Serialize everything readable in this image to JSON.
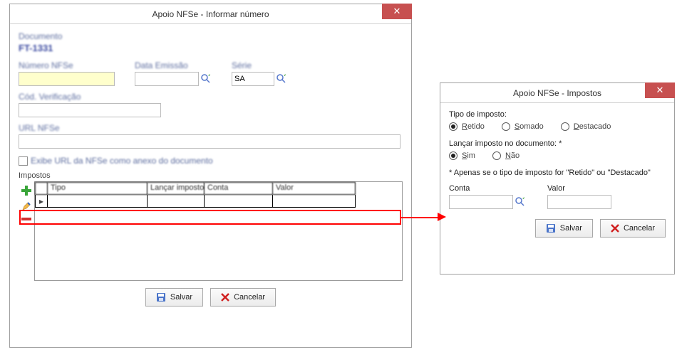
{
  "main": {
    "title": "Apoio NFSe - Informar número",
    "documento_label": "Documento",
    "documento_value": "FT-1331",
    "numero_label": "Número NFSe",
    "numero_value": "",
    "data_label": "Data Emissão",
    "data_value": "",
    "serie_label": "Série",
    "serie_value": "SA",
    "codverif_label": "Cód. Verificação",
    "codverif_value": "",
    "url_label": "URL NFSe",
    "url_value": "",
    "checkbox_label": "Exibe URL da NFSe como anexo do documento",
    "grid_title": "Impostos",
    "grid_headers": [
      "Tipo",
      "Lançar imposto",
      "Conta",
      "Valor"
    ],
    "save_label": "Salvar",
    "cancel_label": "Cancelar"
  },
  "sub": {
    "title": "Apoio NFSe - Impostos",
    "tipo_label": "Tipo de imposto:",
    "tipo_options": {
      "retido": "Retido",
      "somado": "Somado",
      "destacado": "Destacado"
    },
    "tipo_selected": "retido",
    "lancar_label": "Lançar imposto no documento: *",
    "lancar_options": {
      "sim": "Sim",
      "nao": "Não"
    },
    "lancar_selected": "sim",
    "note": "* Apenas se o tipo de imposto for \"Retido\" ou \"Destacado\"",
    "conta_label": "Conta",
    "conta_value": "",
    "valor_label": "Valor",
    "valor_value": "",
    "save_label": "Salvar",
    "cancel_label": "Cancelar"
  }
}
